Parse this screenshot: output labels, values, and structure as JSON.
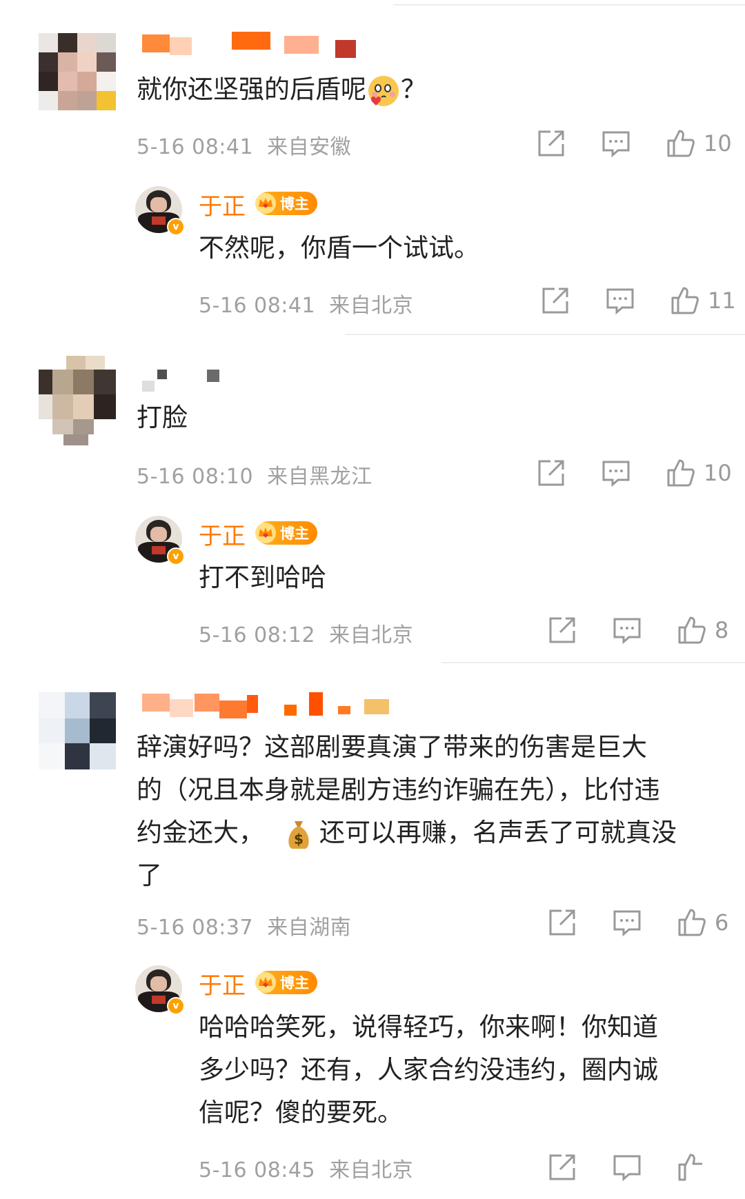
{
  "comments": [
    {
      "text_partial": "就你还坚强的后盾呢",
      "text_suffix": "？",
      "emoji": "blush-kiss-emoji",
      "time": "5-16 08:41",
      "location": "来自安徽",
      "likes": "10",
      "reply": {
        "author": "于正",
        "badge": "博主",
        "text": "不然呢，你盾一个试试。",
        "time": "5-16 08:41",
        "location": "来自北京",
        "likes": "11"
      }
    },
    {
      "text": "打脸",
      "time": "5-16 08:10",
      "location": "来自黑龙江",
      "likes": "10",
      "reply": {
        "author": "于正",
        "badge": "博主",
        "text": "打不到哈哈",
        "time": "5-16 08:12",
        "location": "来自北京",
        "likes": "8"
      }
    },
    {
      "lines": [
        "辞演好吗？这部剧要真演了带来的伤害是巨大",
        "的（况且本身就是剧方违约诈骗在先），比付违",
        "还可以再赚，名声丢了可就真没",
        "了"
      ],
      "line3_prefix": "约金还大，",
      "time": "5-16 08:37",
      "location": "来自湖南",
      "likes": "6",
      "reply": {
        "author": "于正",
        "badge": "博主",
        "lines": [
          "哈哈哈笑死，说得轻巧，你来啊！你知道",
          "多少吗？还有，人家合约没违约，圈内诚",
          "信呢？傻的要死。"
        ],
        "time": "5-16 08:45",
        "location": "来自北京"
      }
    }
  ],
  "icons": {
    "share": "share-icon",
    "comment": "comment-icon",
    "like": "thumbs-up-icon",
    "money": "money-bag-emoji",
    "crown": "crown-icon",
    "verified": "verified-v-icon"
  },
  "colors": {
    "accent": "#ff7a00",
    "meta": "#a0a0a0",
    "divider": "#ededed",
    "badge": "#ff9a10"
  }
}
